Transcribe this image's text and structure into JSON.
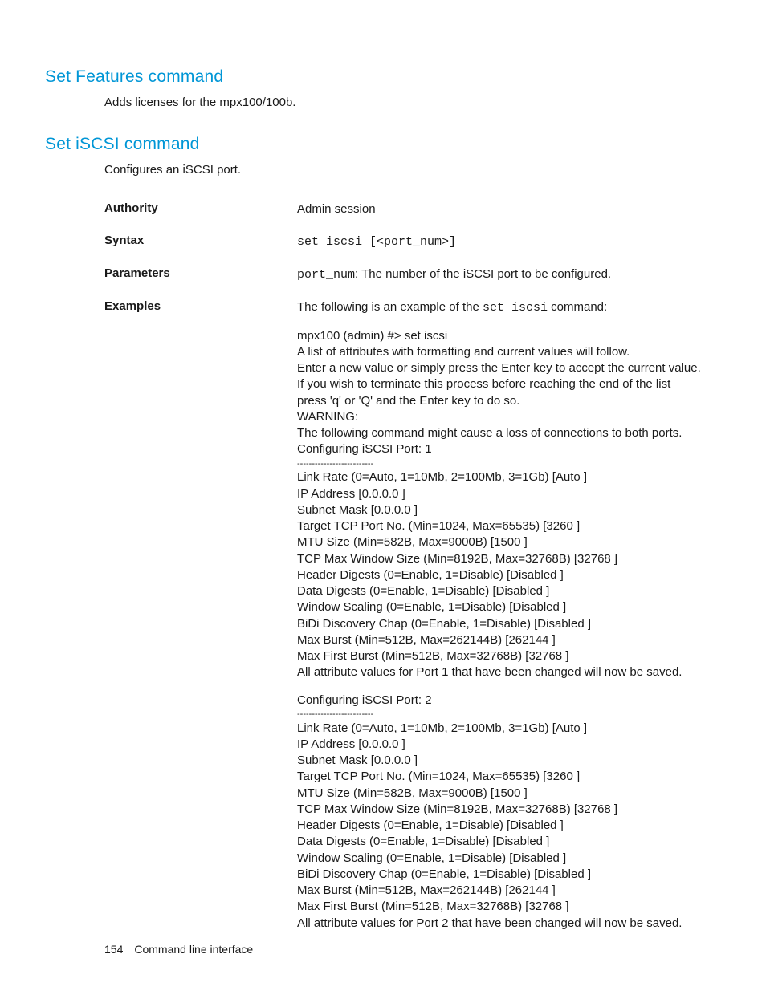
{
  "sections": [
    {
      "heading": "Set Features command",
      "body": "Adds licenses for the mpx100/100b."
    },
    {
      "heading": "Set iSCSI command",
      "body": "Configures an iSCSI port."
    }
  ],
  "spec": {
    "authority": {
      "label": "Authority",
      "value": "Admin session"
    },
    "syntax": {
      "label": "Syntax",
      "value": "set iscsi [<port_num>]"
    },
    "parameters": {
      "label": "Parameters",
      "code": "port_num",
      "rest": ": The number of the iSCSI port to be configured."
    },
    "examples": {
      "label": "Examples",
      "intro_pre": "The following is an example of the ",
      "intro_code": "set iscsi",
      "intro_post": " command:",
      "block1": "mpx100 (admin) #> set iscsi\nA list of attributes with formatting and current values will follow.\nEnter a new value or simply press the Enter key to accept the current value.\nIf you wish to terminate this process before reaching the end of the list\npress 'q' or 'Q' and the Enter key to do so.\nWARNING:\nThe following command might cause a loss of connections to both ports.\nConfiguring iSCSI Port: 1",
      "sep": "--------------------------",
      "block2": "Link Rate (0=Auto, 1=10Mb, 2=100Mb, 3=1Gb) [Auto ]\nIP Address [0.0.0.0 ]\nSubnet Mask [0.0.0.0 ]\nTarget TCP Port No. (Min=1024, Max=65535) [3260 ]\nMTU Size (Min=582B, Max=9000B) [1500 ]\nTCP Max Window Size (Min=8192B, Max=32768B) [32768 ]\nHeader Digests (0=Enable, 1=Disable) [Disabled ]\nData Digests (0=Enable, 1=Disable) [Disabled ]\nWindow Scaling (0=Enable, 1=Disable) [Disabled ]\nBiDi Discovery Chap (0=Enable, 1=Disable) [Disabled ]\nMax Burst (Min=512B, Max=262144B) [262144 ]\nMax First Burst (Min=512B, Max=32768B) [32768 ]\nAll attribute values for Port 1 that have been changed will now be saved.",
      "block3_hdr": "Configuring iSCSI Port: 2",
      "block3": "Link Rate (0=Auto, 1=10Mb, 2=100Mb, 3=1Gb) [Auto ]\nIP Address [0.0.0.0 ]\nSubnet Mask [0.0.0.0 ]\nTarget TCP Port No. (Min=1024, Max=65535) [3260 ]\nMTU Size (Min=582B, Max=9000B) [1500 ]\nTCP Max Window Size (Min=8192B, Max=32768B) [32768 ]\nHeader Digests (0=Enable, 1=Disable) [Disabled ]\nData Digests (0=Enable, 1=Disable) [Disabled ]\nWindow Scaling (0=Enable, 1=Disable) [Disabled ]\nBiDi Discovery Chap (0=Enable, 1=Disable) [Disabled ]\nMax Burst (Min=512B, Max=262144B) [262144 ]\nMax First Burst (Min=512B, Max=32768B) [32768 ]\nAll attribute values for Port 2 that have been changed will now be saved."
    }
  },
  "footer": {
    "page": "154",
    "title": "Command line interface"
  }
}
